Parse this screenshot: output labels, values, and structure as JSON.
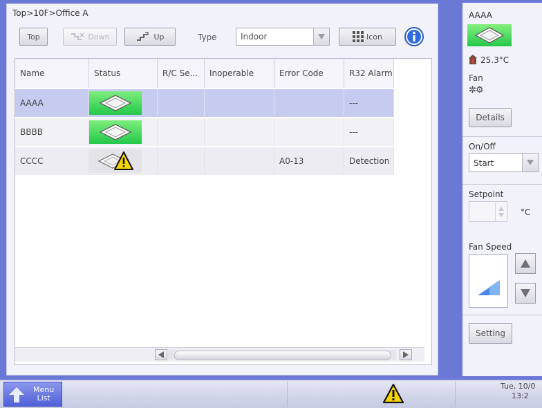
{
  "breadcrumb": "Top>10F>Office A",
  "toolbar": {
    "top_label": "Top",
    "down_label": "Down",
    "up_label": "Up",
    "type_label": "Type",
    "type_value": "Indoor",
    "view_label": "Icon"
  },
  "table": {
    "columns": [
      "Name",
      "Status",
      "R/C Se...",
      "Inoperable",
      "Error Code",
      "R32 Alarm"
    ],
    "rows": [
      {
        "name": "AAAA",
        "status": "on",
        "rc": "",
        "inoperable": "",
        "error": "",
        "r32": "---"
      },
      {
        "name": "BBBB",
        "status": "on",
        "rc": "",
        "inoperable": "",
        "error": "",
        "r32": "---"
      },
      {
        "name": "CCCC",
        "status": "warning",
        "rc": "",
        "inoperable": "",
        "error": "A0-13",
        "r32": "Detection"
      }
    ]
  },
  "side": {
    "unit_name": "AAAA",
    "temperature": "25.3°C",
    "mode": "Fan",
    "mode_icon": "fan-icon",
    "details_label": "Details",
    "onoff_label": "On/Off",
    "onoff_value": "Start",
    "setpoint_label": "Setpoint",
    "setpoint_value": "",
    "setpoint_unit": "°C",
    "fanspeed_label": "Fan Speed",
    "setting_label": "Setting"
  },
  "taskbar": {
    "menu_line1": "Menu",
    "menu_line2": "List",
    "date": "Tue, 10/0",
    "time": "13:2"
  },
  "colors": {
    "accent": "#6a78d6",
    "status_on": "#2ecc55",
    "selected_row": "#c7cbf0",
    "warning": "#f5d400"
  }
}
